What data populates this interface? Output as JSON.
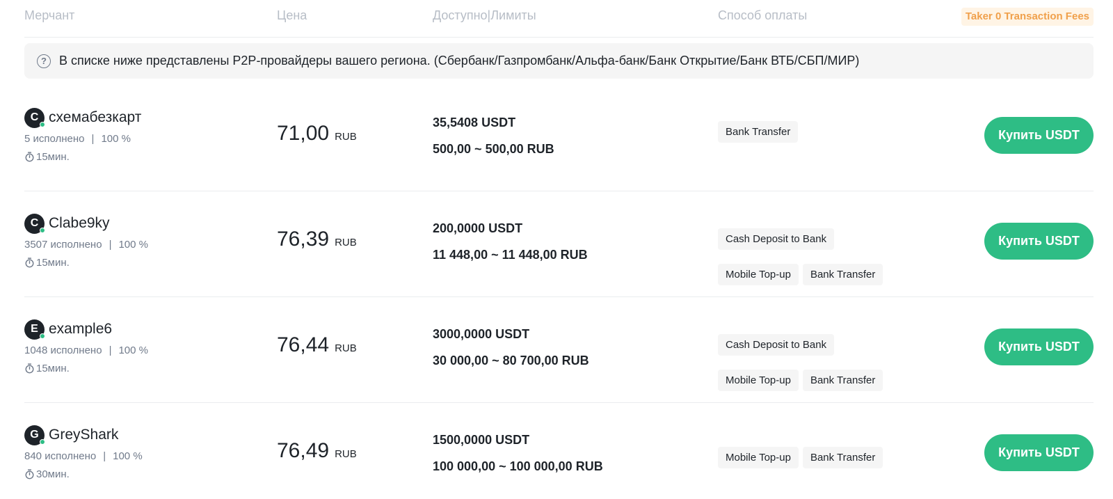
{
  "header": {
    "merchant": "Мерчант",
    "price": "Цена",
    "available_limits": "Доступно|Лимиты",
    "payment_method": "Способ оплаты",
    "taker_fees": "Taker 0 Transaction Fees"
  },
  "notice": {
    "text": "В списке ниже представлены P2P-провайдеры вашего региона. (Сбербанк/Газпромбанк/Альфа-банк/Банк Открытие/Банк ВТБ/СБП/МИР)"
  },
  "offers": [
    {
      "avatar_letter": "C",
      "name": "схемабезкарт",
      "orders": "5 исполнено",
      "completion": "100 %",
      "time": "15мин.",
      "price": "71,00",
      "currency": "RUB",
      "available": "35,5408 USDT",
      "limits": "500,00 ~ 500,00 RUB",
      "payments": [
        "Bank Transfer"
      ],
      "button": "Купить USDT"
    },
    {
      "avatar_letter": "C",
      "name": "Clabe9ky",
      "orders": "3507 исполнено",
      "completion": "100 %",
      "time": "15мин.",
      "price": "76,39",
      "currency": "RUB",
      "available": "200,0000 USDT",
      "limits": "11 448,00 ~ 11 448,00 RUB",
      "payments": [
        "Cash Deposit to Bank",
        "Mobile Top-up",
        "Bank Transfer"
      ],
      "button": "Купить USDT"
    },
    {
      "avatar_letter": "E",
      "name": "example6",
      "orders": "1048 исполнено",
      "completion": "100 %",
      "time": "15мин.",
      "price": "76,44",
      "currency": "RUB",
      "available": "3000,0000 USDT",
      "limits": "30 000,00 ~ 80 700,00 RUB",
      "payments": [
        "Cash Deposit to Bank",
        "Mobile Top-up",
        "Bank Transfer"
      ],
      "button": "Купить USDT"
    },
    {
      "avatar_letter": "G",
      "name": "GreyShark",
      "orders": "840 исполнено",
      "completion": "100 %",
      "time": "30мин.",
      "price": "76,49",
      "currency": "RUB",
      "available": "1500,0000 USDT",
      "limits": "100 000,00 ~ 100 000,00 RUB",
      "payments": [
        "Mobile Top-up",
        "Bank Transfer"
      ],
      "button": "Купить USDT"
    }
  ],
  "colors": {
    "accent": "#2ebd85",
    "muted_text": "#707a8a",
    "header_text": "#b7bdc6",
    "badge_text": "#f0a04b"
  },
  "icons": {
    "notice": "question-circle-icon",
    "timer": "stopwatch-icon",
    "online": "online-dot-icon"
  }
}
